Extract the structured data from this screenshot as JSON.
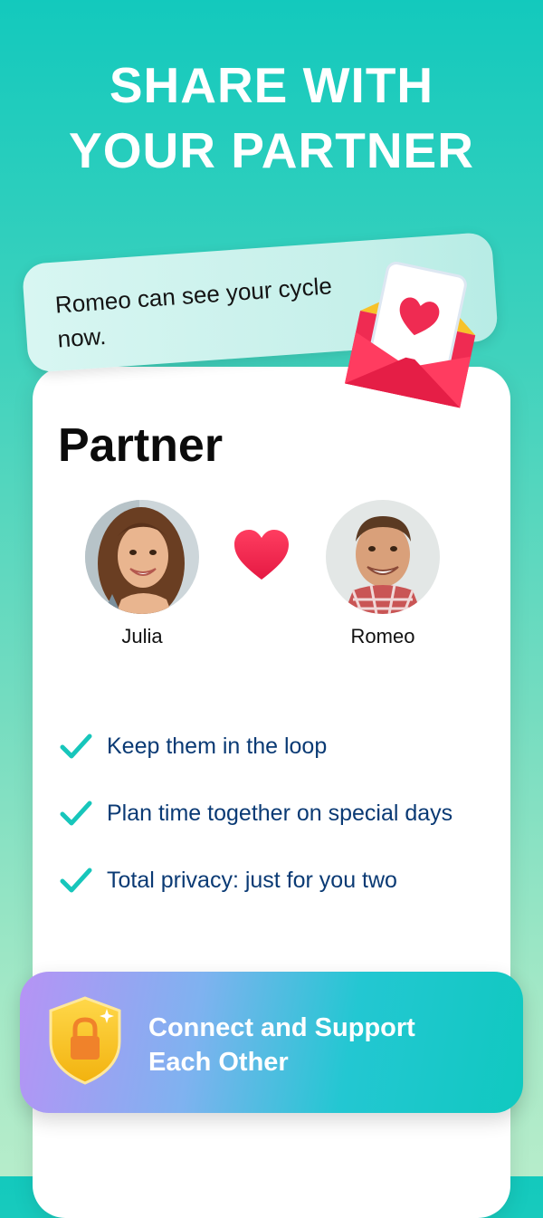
{
  "headline": {
    "line1": "SHARE WITH",
    "line2": "YOUR PARTNER"
  },
  "notice": {
    "text": "Romeo can see your cycle now.",
    "icon": "envelope-heart-icon"
  },
  "card": {
    "title": "Partner",
    "partners": [
      {
        "name": "Julia"
      },
      {
        "name": "Romeo"
      }
    ],
    "center_icon": "heart-icon",
    "features": [
      {
        "text": "Keep them in the loop",
        "icon": "check-icon"
      },
      {
        "text": "Plan time together on special days",
        "icon": "check-icon"
      },
      {
        "text": "Total privacy: just for you two",
        "icon": "check-icon"
      }
    ]
  },
  "banner": {
    "line1": "Connect and Support",
    "line2": "Each Other",
    "icon": "shield-lock-icon"
  },
  "colors": {
    "accent": "#17c6bb",
    "heart": "#f0234e",
    "feature_text": "#0a3a74",
    "shield": "#f8c21a"
  }
}
